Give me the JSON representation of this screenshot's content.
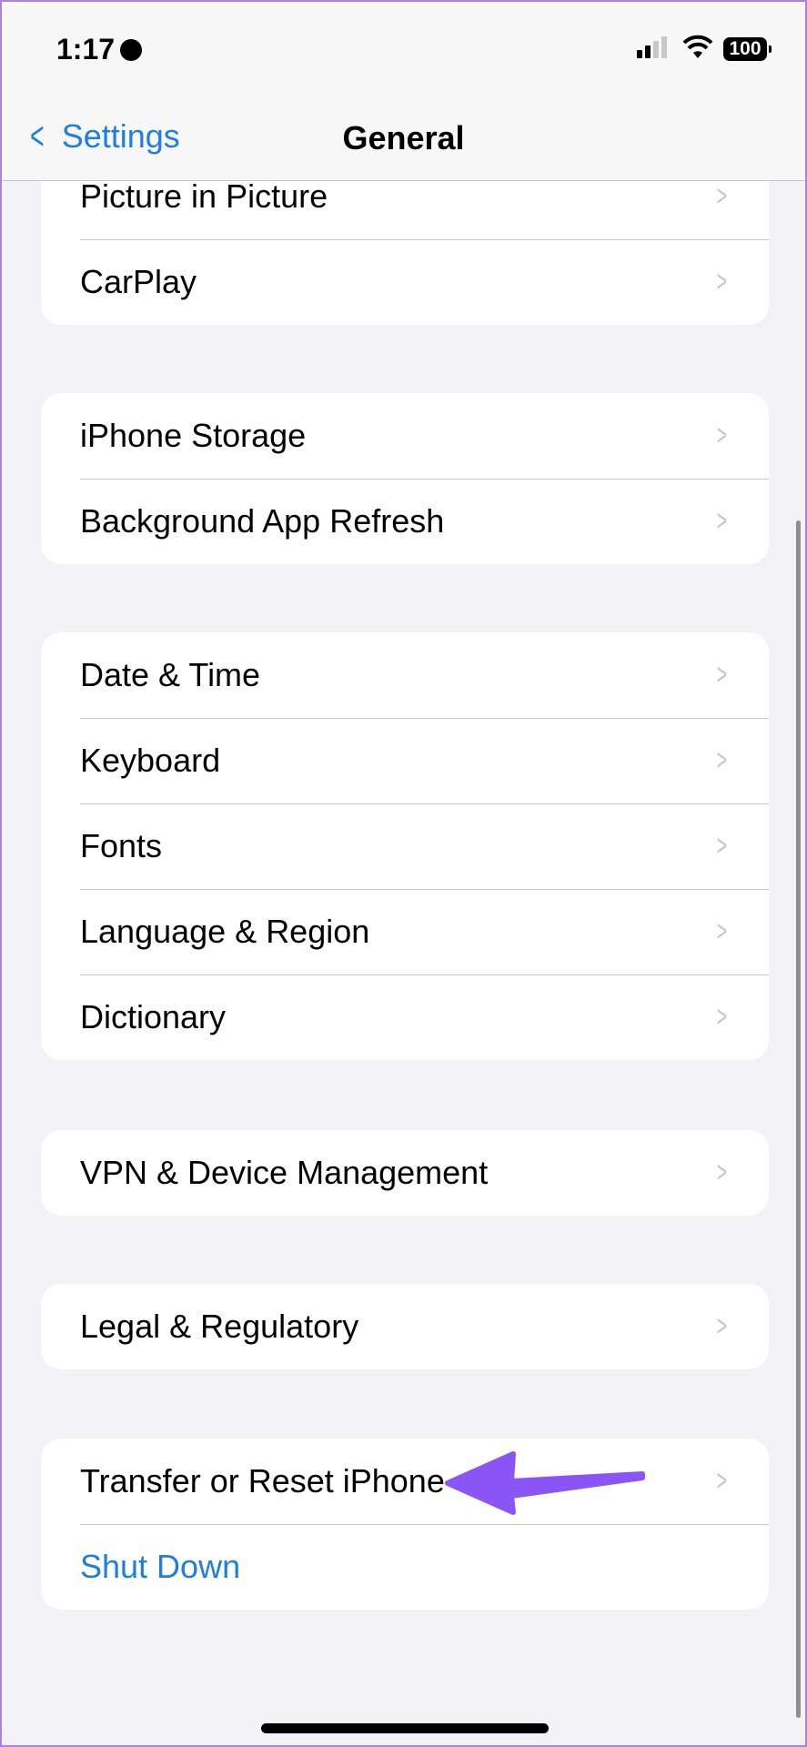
{
  "status_bar": {
    "time": "1:17",
    "battery": "100",
    "icons": [
      "globe-icon",
      "signal-icon",
      "wifi-icon",
      "battery-icon"
    ]
  },
  "nav": {
    "back_label": "Settings",
    "title": "General"
  },
  "groups": [
    {
      "items": [
        "Picture in Picture",
        "CarPlay"
      ]
    },
    {
      "items": [
        "iPhone Storage",
        "Background App Refresh"
      ]
    },
    {
      "items": [
        "Date & Time",
        "Keyboard",
        "Fonts",
        "Language & Region",
        "Dictionary"
      ]
    },
    {
      "items": [
        "VPN & Device Management"
      ]
    },
    {
      "items": [
        "Legal & Regulatory"
      ]
    },
    {
      "items": [
        "Transfer or Reset iPhone"
      ],
      "action": "Shut Down"
    }
  ],
  "colors": {
    "accent": "#1f7ee0",
    "annotation_arrow": "#8b55f5",
    "background": "#f2f2f7"
  }
}
